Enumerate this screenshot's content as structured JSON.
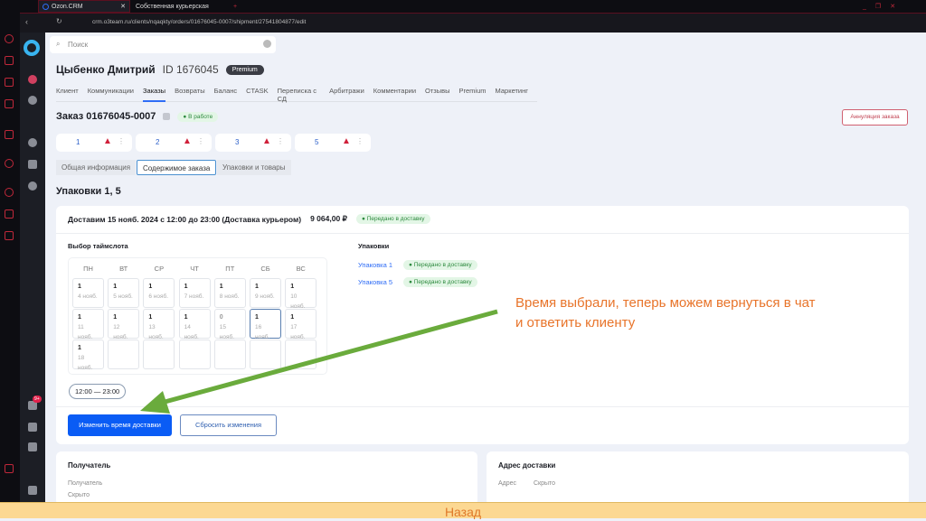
{
  "browser": {
    "tabs": [
      "Ozon.CRM",
      "Собственная курьерская"
    ],
    "url": "crm.o3team.ru/clients/nqaqkty/orders/01676045-0007/shipment/27541804877/edit"
  },
  "search": {
    "placeholder": "Поиск"
  },
  "client": {
    "name": "Цыбенко Дмитрий",
    "id": "ID 1676045",
    "badge": "Premium"
  },
  "nav": [
    "Клиент",
    "Коммуникации",
    "Заказы",
    "Возвраты",
    "Баланс",
    "CTASK",
    "Переписка с СД",
    "Арбитражи",
    "Комментарии",
    "Отзывы",
    "Premium",
    "Маркетинг"
  ],
  "order": {
    "title": "Заказ 01676045-0007",
    "status": "В работе",
    "cancel": "Аннуляция заказа"
  },
  "packages": [
    "1",
    "2",
    "3",
    "5"
  ],
  "subtabs": [
    "Общая информация",
    "Содержимое заказа",
    "Упаковки и товары"
  ],
  "section_title": "Упаковки 1, 5",
  "delivery": {
    "header": "Доставим 15 нояб. 2024 с 12:00 до 23:00 (Доставка курьером)",
    "price": "9 064,00 ₽",
    "status": "Передано в доставку"
  },
  "timeslot": {
    "title": "Выбор таймслота",
    "days": [
      "ПН",
      "ВТ",
      "СР",
      "ЧТ",
      "ПТ",
      "СБ",
      "ВС"
    ],
    "cells": [
      {
        "n": "1",
        "d": "4 нояб."
      },
      {
        "n": "1",
        "d": "5 нояб."
      },
      {
        "n": "1",
        "d": "6 нояб."
      },
      {
        "n": "1",
        "d": "7 нояб."
      },
      {
        "n": "1",
        "d": "8 нояб."
      },
      {
        "n": "1",
        "d": "9 нояб."
      },
      {
        "n": "1",
        "d": "10 нояб."
      },
      {
        "n": "1",
        "d": "11 нояб."
      },
      {
        "n": "1",
        "d": "12 нояб."
      },
      {
        "n": "1",
        "d": "13 нояб."
      },
      {
        "n": "1",
        "d": "14 нояб."
      },
      {
        "n": "0",
        "d": "15 нояб."
      },
      {
        "n": "1",
        "d": "16 нояб."
      },
      {
        "n": "1",
        "d": "17 нояб."
      },
      {
        "n": "1",
        "d": "18 нояб."
      }
    ],
    "time": "12:00 — 23:00"
  },
  "buttons": {
    "change": "Изменить время доставки",
    "reset": "Сбросить изменения"
  },
  "pack_list": {
    "title": "Упаковки",
    "items": [
      {
        "name": "Упаковка 1",
        "status": "Передано в доставку"
      },
      {
        "name": "Упаковка 5",
        "status": "Передано в доставку"
      }
    ]
  },
  "annotation": {
    "line1": "Время выбрали, теперь можем вернуться в чат",
    "line2": "и ответить клиенту"
  },
  "recipient": {
    "title": "Получатель",
    "label": "Получатель",
    "value": "Скрыто"
  },
  "address": {
    "title": "Адрес доставки",
    "label": "Адрес",
    "value": "Скрыто"
  },
  "footer": {
    "back": "Назад"
  },
  "notif_badge": "9+"
}
